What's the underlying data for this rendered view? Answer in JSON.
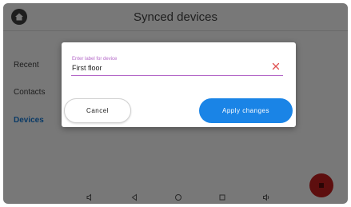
{
  "header": {
    "title": "Synced devices",
    "home_icon": "home-icon"
  },
  "sidebar": {
    "items": [
      {
        "label": "Recent",
        "active": false
      },
      {
        "label": "Contacts",
        "active": false
      },
      {
        "label": "Devices",
        "active": true
      }
    ]
  },
  "dialog": {
    "input": {
      "label": "Enter label for device",
      "value": "First floor",
      "clear_icon": "close-icon"
    },
    "cancel_label": "Cancel",
    "apply_label": "Apply changes"
  },
  "fab": {
    "icon": "fab-icon"
  },
  "system_nav": {
    "icons": [
      "volume-down-icon",
      "back-icon",
      "home-circle-icon",
      "recents-icon",
      "volume-up-icon"
    ]
  },
  "colors": {
    "scrim": "#787878",
    "accent": "#1a84e6",
    "input_accent": "#b468c8",
    "clear": "#e05050",
    "fab": "#5d0e0e",
    "active_nav": "#0a3a66"
  }
}
